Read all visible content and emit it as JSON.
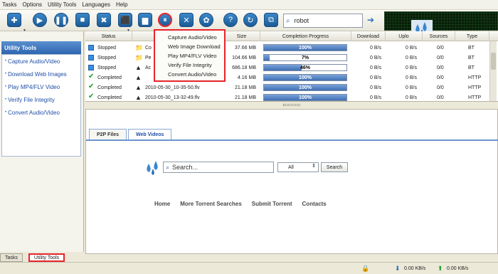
{
  "menu": [
    "Tasks",
    "Options",
    "Utility Tools",
    "Languages",
    "Help"
  ],
  "toolbar": {
    "buttons": [
      "new-task-icon",
      "play-icon",
      "pause-icon",
      "stop-icon",
      "delete-icon",
      "folder-icon",
      "utility-tools-icon",
      "tools-icon",
      "settings-icon",
      "help-icon",
      "update-icon",
      "about-icon"
    ],
    "search_value": "robot"
  },
  "left_panel": {
    "title": "Utility Tools",
    "items": [
      "Capture Audio/Video",
      "Download Web Images",
      "Play MP4/FLV Video",
      "Verify File Integrity",
      "Convert Audio/Video"
    ]
  },
  "bottom_tabs": [
    "Tasks",
    "Utility Tools"
  ],
  "table": {
    "headers": [
      "Status",
      "",
      "Size",
      "Completion Progress",
      "Download",
      "Uplo",
      "Sources",
      "Type"
    ],
    "rows": [
      {
        "status": "Stopped",
        "name": "Co",
        "size": "37.66 MB",
        "progress": 100,
        "progress_label": "100%",
        "download": "0 B/s",
        "upload": "0 B/s",
        "sources": "0/0",
        "type": "BT",
        "icon": "folder"
      },
      {
        "status": "Stopped",
        "name": "Pe",
        "size": "104.66 MB",
        "progress": 7,
        "progress_label": "7%",
        "download": "0 B/s",
        "upload": "0 B/s",
        "sources": "0/0",
        "type": "BT",
        "icon": "folder"
      },
      {
        "status": "Stopped",
        "name": "Ac",
        "size": "686.18 MB",
        "progress": 46,
        "progress_label": "46%",
        "download": "0 B/s",
        "upload": "0 B/s",
        "sources": "0/0",
        "type": "BT",
        "icon": "cone"
      },
      {
        "status": "Completed",
        "name": "",
        "size": "4.16 MB",
        "progress": 100,
        "progress_label": "100%",
        "download": "0 B/s",
        "upload": "0 B/s",
        "sources": "0/0",
        "type": "HTTP",
        "icon": "cone"
      },
      {
        "status": "Completed",
        "name": "2010-05-30_10-35-50.flv",
        "size": "21.18 MB",
        "progress": 100,
        "progress_label": "100%",
        "download": "0 B/s",
        "upload": "0 B/s",
        "sources": "0/0",
        "type": "HTTP",
        "icon": "cone"
      },
      {
        "status": "Completed",
        "name": "2010-05-30_13-32-49.flv",
        "size": "21.18 MB",
        "progress": 100,
        "progress_label": "100%",
        "download": "0 B/s",
        "upload": "0 B/s",
        "sources": "0/0",
        "type": "HTTP",
        "icon": "cone"
      }
    ]
  },
  "dropdown": {
    "items": [
      "Capture Audio/Video",
      "Web Image Download",
      "Play MP4/FLV Video",
      "Verify File Integrity",
      "Convert Audio/Video"
    ]
  },
  "browser": {
    "tabs": [
      "P2P Files",
      "Web Videos"
    ],
    "search_placeholder": "Search...",
    "select_value": "All",
    "search_button": "Search",
    "links": [
      "Home",
      "More Torrent Searches",
      "Submit Torrent",
      "Contacts"
    ]
  },
  "status": {
    "download_speed": "0.00 KB/s",
    "upload_speed": "0.00 KB/s"
  },
  "colors": {
    "accent": "#2e65b0",
    "highlight": "#e8242c",
    "progress": "#3f6fb4"
  }
}
